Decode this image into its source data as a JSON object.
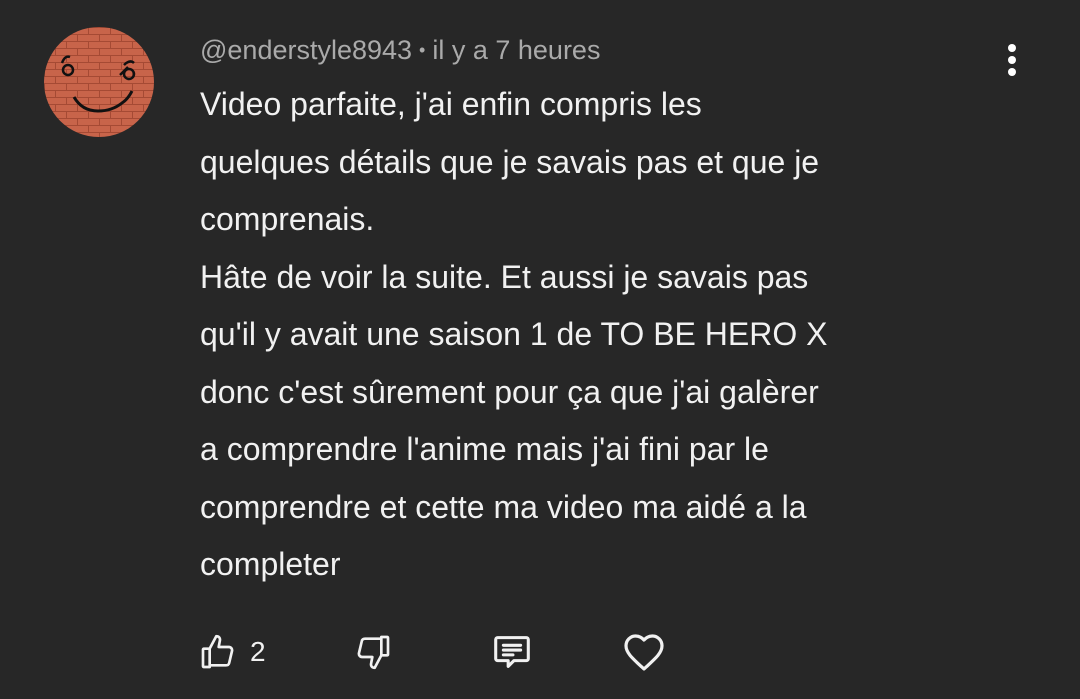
{
  "comment": {
    "author": "@enderstyle8943",
    "separator": "•",
    "timestamp": "il y a 7 heures",
    "lines": [
      "Video parfaite, j'ai enfin compris les",
      "quelques détails que je savais pas et que je",
      "comprenais.",
      "Hâte de voir la suite. Et aussi je savais pas",
      "qu'il y avait une saison 1 de TO BE HERO X",
      "donc c'est sûrement pour ça que j'ai galèrer",
      "a comprendre l'anime mais j'ai fini par le",
      "comprendre et cette ma video ma aidé a la",
      "completer"
    ],
    "avatar_icon": "brick-wall-face-avatar",
    "avatar_color": "#c8644a"
  },
  "actions": {
    "like_icon": "thumbs-up-icon",
    "like_count": "2",
    "dislike_icon": "thumbs-down-icon",
    "reply_icon": "reply-comment-icon",
    "heart_icon": "heart-icon",
    "menu_icon": "more-vert-icon"
  },
  "colors": {
    "background": "#272727",
    "text_primary": "#f1f1f1",
    "text_secondary": "#aaaaaa"
  }
}
